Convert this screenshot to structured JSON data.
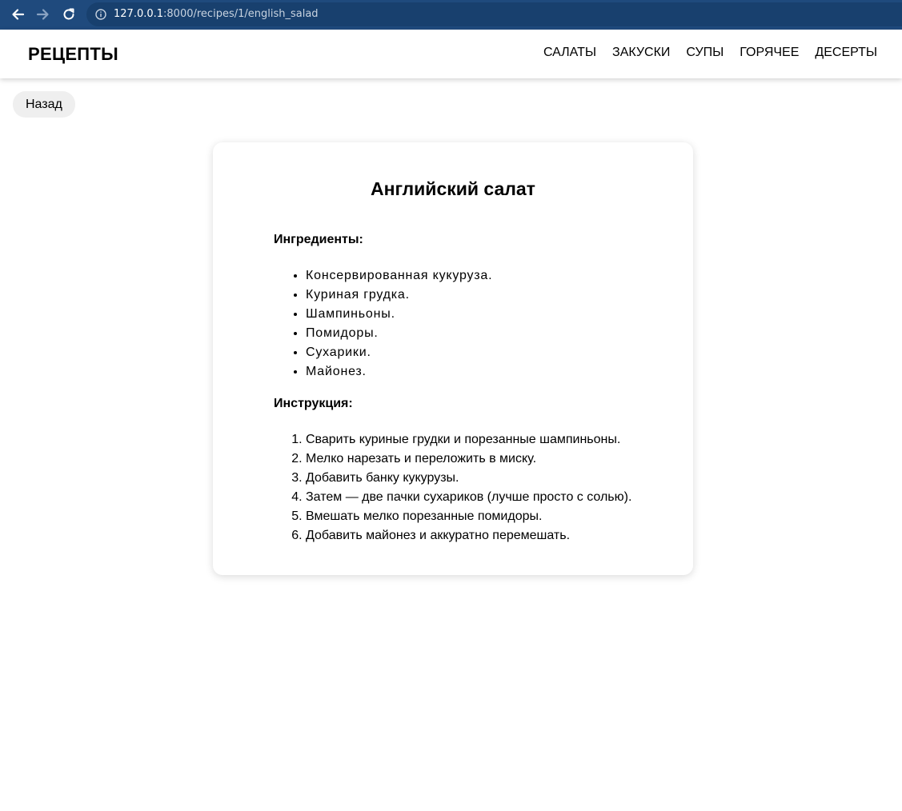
{
  "browser": {
    "url_host": "127.0.0.1",
    "url_rest": ":8000/recipes/1/english_salad",
    "back_icon": "arrow-left-icon",
    "forward_icon": "arrow-right-icon",
    "reload_icon": "reload-icon",
    "info_icon": "info-icon",
    "bar_color": "#1f4a7d"
  },
  "header": {
    "logo": "РЕЦЕПТЫ",
    "nav": [
      "САЛАТЫ",
      "ЗАКУСКИ",
      "СУПЫ",
      "ГОРЯЧЕЕ",
      "ДЕСЕРТЫ"
    ]
  },
  "back_button": {
    "label": "Назад"
  },
  "recipe": {
    "title": "Английский салат",
    "ingredients_heading": "Ингредиенты:",
    "ingredients": [
      "Консервированная кукуруза.",
      "Куриная грудка.",
      "Шампиньоны.",
      "Помидоры.",
      "Сухарики.",
      "Майонез."
    ],
    "instructions_heading": "Инструкция:",
    "instructions": [
      "Сварить куриные грудки и порезанные шампиньоны.",
      "Мелко нарезать и переложить в миску.",
      "Добавить банку кукурузы.",
      "Затем — две пачки сухариков (лучше просто с солью).",
      "Вмешать мелко порезанные помидоры.",
      "Добавить майонез и аккуратно перемешать."
    ]
  }
}
